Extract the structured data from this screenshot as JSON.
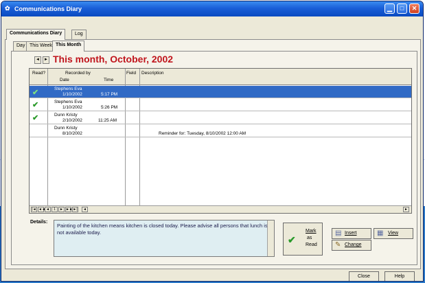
{
  "window": {
    "title": "Communications Diary",
    "controls": {
      "minimize": "▁",
      "maximize": "□",
      "close": "✕"
    }
  },
  "outer_tabs": [
    {
      "label": "Communications Diary",
      "active": true
    },
    {
      "label": "Log",
      "active": false
    }
  ],
  "inner_tabs": [
    {
      "label": "Day",
      "active": false
    },
    {
      "label": "This Week",
      "active": false
    },
    {
      "label": "This Month",
      "active": true
    }
  ],
  "navigation": {
    "prev": "◄",
    "next": "►"
  },
  "month_title": "This month, October, 2002",
  "table": {
    "columns": {
      "read": "Read?",
      "recorded_by": "Recorded by",
      "date": "Date",
      "time": "Time",
      "field": "Field",
      "description": "Description"
    },
    "rows": [
      {
        "read": "✔",
        "recorded_by": "Stephens Eva",
        "date": "1/10/2002",
        "time": "5:17 PM",
        "description": "",
        "selected": true
      },
      {
        "read": "✔",
        "recorded_by": "Stephens Eva",
        "date": "1/10/2002",
        "time": "5:26 PM",
        "description": "",
        "selected": false
      },
      {
        "read": "✔",
        "recorded_by": "Dunn Kristy",
        "date": "2/10/2002",
        "time": "11:25 AM",
        "description": "",
        "selected": false
      },
      {
        "read": "",
        "recorded_by": "Dunn Kristy",
        "date": "8/10/2002",
        "time": "",
        "description": "Reminder for: Tuesday, 8/10/2002 12:00 AM",
        "selected": false
      }
    ],
    "footer_nav": [
      "|◄",
      "◄◄",
      "◄",
      "1",
      "►",
      "►►",
      "►|",
      "◄",
      "►"
    ]
  },
  "details": {
    "label": "Details:",
    "text": "Painting of the kitchen means kitchen is closed today. Please advise all persons that lunch is not available today."
  },
  "buttons": {
    "mark_as_read": {
      "line1": "Mark",
      "line2": "as",
      "line3": "Read",
      "icon": "check-icon"
    },
    "insert": "Insert",
    "change": "Change",
    "view": "View",
    "close": "Close",
    "help": "Help"
  },
  "colors": {
    "title_bar": "#1a5fd8",
    "month_title": "#c0141c",
    "selected_row": "#316ac5",
    "details_bg": "#dfeef2",
    "check": "#2a9a2a"
  }
}
